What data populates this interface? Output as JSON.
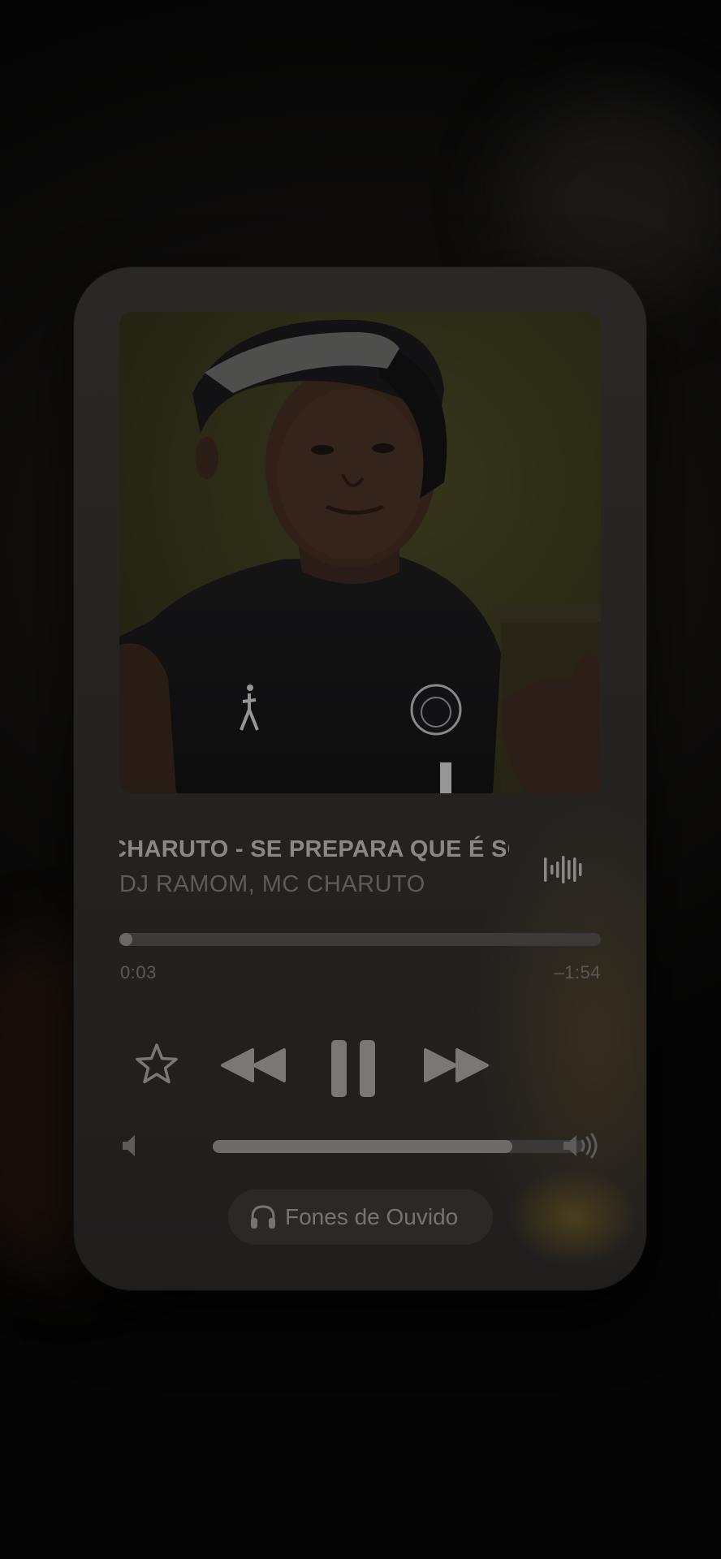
{
  "now_playing": {
    "title": "CHARUTO - SE PREPARA QUE É SO",
    "artist": "DJ RAMOM, MC CHARUTO",
    "progress_fraction": 0.025,
    "elapsed": "0:03",
    "remaining": "–1:54"
  },
  "controls": {
    "favorite_icon": "star-outline-icon",
    "previous_icon": "backward-icon",
    "play_pause_icon": "pause-icon",
    "next_icon": "forward-icon",
    "waveform_icon": "waveform-icon"
  },
  "volume": {
    "level_fraction": 0.81,
    "low_icon": "speaker-low-icon",
    "high_icon": "speaker-high-icon"
  },
  "output": {
    "icon": "headphones-icon",
    "label": "Fones de Ouvido"
  },
  "colors": {
    "card": "#252321",
    "text_primary": "#8a8886",
    "text_secondary": "#5e5c5a",
    "controls": "#7a7876"
  }
}
